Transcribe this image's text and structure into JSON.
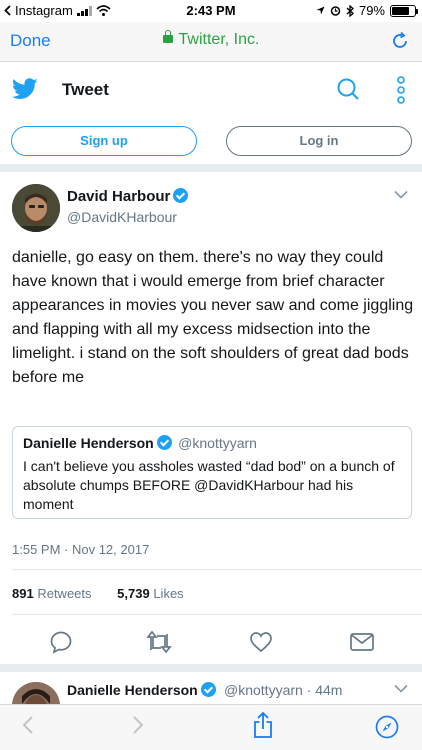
{
  "status_bar": {
    "back_app": "Instagram",
    "time": "2:43 PM",
    "battery": "79%",
    "battery_level": 0.79
  },
  "browser": {
    "done_label": "Done",
    "site": "Twitter, Inc."
  },
  "header": {
    "title": "Tweet"
  },
  "auth": {
    "signup_label": "Sign up",
    "login_label": "Log in"
  },
  "tweet": {
    "author_name": "David Harbour",
    "author_handle": "@DavidKHarbour",
    "text": "danielle, go easy on them. there's no way they could have known that i would emerge from brief character appearances in movies you never saw and come jiggling and flapping with all my excess midsection into the limelight. i stand on the soft shoulders of great dad bods before me",
    "quote": {
      "name": "Danielle Henderson",
      "handle": "@knottyyarn",
      "text": "I can't believe you assholes wasted “dad bod” on a bunch of absolute chumps BEFORE @DavidKHarbour had his moment"
    },
    "timestamp": "1:55 PM · Nov 12, 2017",
    "retweets_count": "891",
    "retweets_label": "Retweets",
    "likes_count": "5,739",
    "likes_label": "Likes"
  },
  "next_tweet": {
    "name": "Danielle Henderson",
    "handle_time": "@knottyyarn · 44m"
  },
  "colors": {
    "twitter_blue": "#1da1f2",
    "ios_blue": "#1a7cf2",
    "secure_green": "#2aa443",
    "secondary_text": "#657786"
  },
  "icons": [
    "chevron-left-icon",
    "signal-icon",
    "wifi-icon",
    "location-icon",
    "alarm-icon",
    "bluetooth-icon",
    "battery-icon",
    "lock-icon",
    "reload-icon",
    "twitter-bird-icon",
    "search-icon",
    "more-vertical-icon",
    "verified-icon",
    "chevron-down-icon",
    "reply-icon",
    "retweet-icon",
    "like-icon",
    "dm-icon",
    "back-arrow-icon",
    "forward-arrow-icon",
    "share-icon",
    "compass-icon"
  ]
}
